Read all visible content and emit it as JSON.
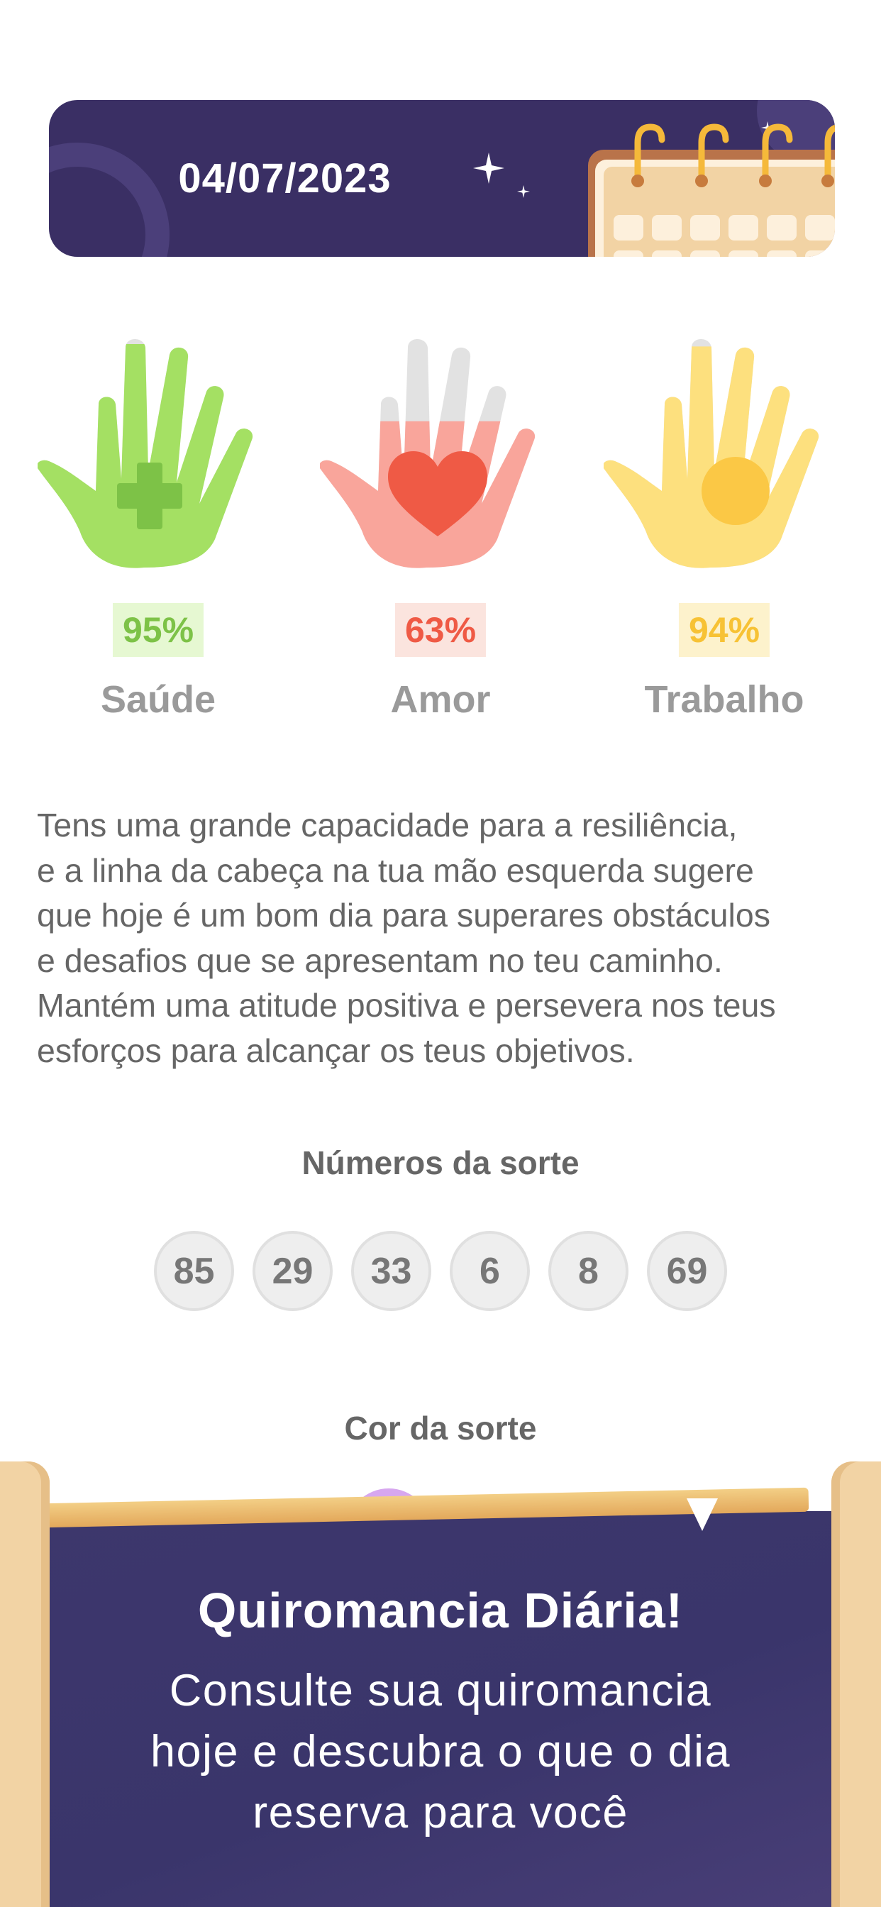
{
  "date": "04/07/2023",
  "scores": [
    {
      "id": "saude",
      "percent": "95%",
      "label": "Saúde",
      "fill": 0.95,
      "color": "#a4e063",
      "badge_bg": "#e6f8d2",
      "badge_text": "#7dc247",
      "symbol": "plus-icon"
    },
    {
      "id": "amor",
      "percent": "63%",
      "label": "Amor",
      "fill": 0.63,
      "color": "#f9a59b",
      "badge_bg": "#fbe4de",
      "badge_text": "#ef5a45",
      "symbol": "heart-icon"
    },
    {
      "id": "trabalho",
      "percent": "94%",
      "label": "Trabalho",
      "fill": 0.94,
      "color": "#fde07e",
      "badge_bg": "#fdf2cc",
      "badge_text": "#f7c235",
      "symbol": "sun-icon"
    }
  ],
  "description": "Tens uma grande capacidade para a resiliência,\ne a linha da cabeça na tua mão esquerda sugere\nque hoje é um bom dia para superares obstáculos\ne desafios que se apresentam no teu caminho.\nMantém uma atitude positiva e persevera nos teus\nesforços para alcançar os teus objetivos.",
  "lucky_numbers": {
    "title": "Números da sorte",
    "values": [
      "85",
      "29",
      "33",
      "6",
      "8",
      "69"
    ]
  },
  "lucky_color": {
    "title": "Cor da sorte",
    "color": "#d7a7ef"
  },
  "promo": {
    "title": "Quiromancia Diária!",
    "subtitle_lines": [
      "Consulte sua quiromancia",
      "hoje e descubra o que o dia",
      "reserva para você"
    ]
  },
  "colors": {
    "banner_bg": "#3a2f64",
    "panel_bg": "#3d376c",
    "hand_empty": "#e2e2e2"
  }
}
